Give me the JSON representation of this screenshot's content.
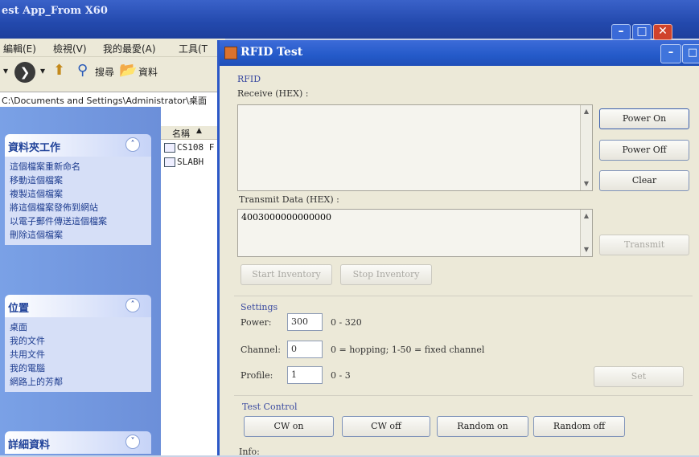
{
  "background_window": {
    "title": "est App_From X60",
    "menu": [
      "編輯(E)",
      "檢視(V)",
      "我的最愛(A)",
      "工具(T"
    ],
    "toolbar": {
      "back_label": "",
      "search_label": "搜尋",
      "folders_label": "資料"
    },
    "address": "C:\\Documents and Settings\\Administrator\\桌面",
    "task_panels": [
      {
        "title": "資料夾工作",
        "items": [
          "這個檔案重新命名",
          "移動這個檔案",
          "複製這個檔案",
          "將這個檔案發佈到網站",
          "以電子郵件傳送這個檔案",
          "刪除這個檔案"
        ]
      },
      {
        "title": "位置",
        "items": [
          "桌面",
          "我的文件",
          "共用文件",
          "我的電腦",
          "網路上的芳鄰"
        ]
      },
      {
        "title": "詳細資料",
        "items": []
      }
    ],
    "list_header": "名稱",
    "files": [
      "CS108 F",
      "SLABH"
    ]
  },
  "rfid_window": {
    "title": "RFID Test",
    "rfid_group": "RFID",
    "receive_label": "Receive (HEX) :",
    "receive_value": "",
    "transmit_label": "Transmit Data (HEX) :",
    "transmit_value": "4003000000000000",
    "buttons": {
      "power_on": "Power On",
      "power_off": "Power Off",
      "clear": "Clear",
      "transmit": "Transmit",
      "start_inventory": "Start Inventory",
      "stop_inventory": "Stop Inventory",
      "set": "Set"
    },
    "settings": {
      "group": "Settings",
      "power_label": "Power:",
      "power_value": "300",
      "power_range": "0 - 320",
      "channel_label": "Channel:",
      "channel_value": "0",
      "channel_range": "0 = hopping; 1-50 = fixed channel",
      "profile_label": "Profile:",
      "profile_value": "1",
      "profile_range": "0 - 3"
    },
    "test_control": {
      "group": "Test Control",
      "cw_on": "CW on",
      "cw_off": "CW off",
      "random_on": "Random on",
      "random_off": "Random off"
    },
    "info_label": "Info:"
  }
}
